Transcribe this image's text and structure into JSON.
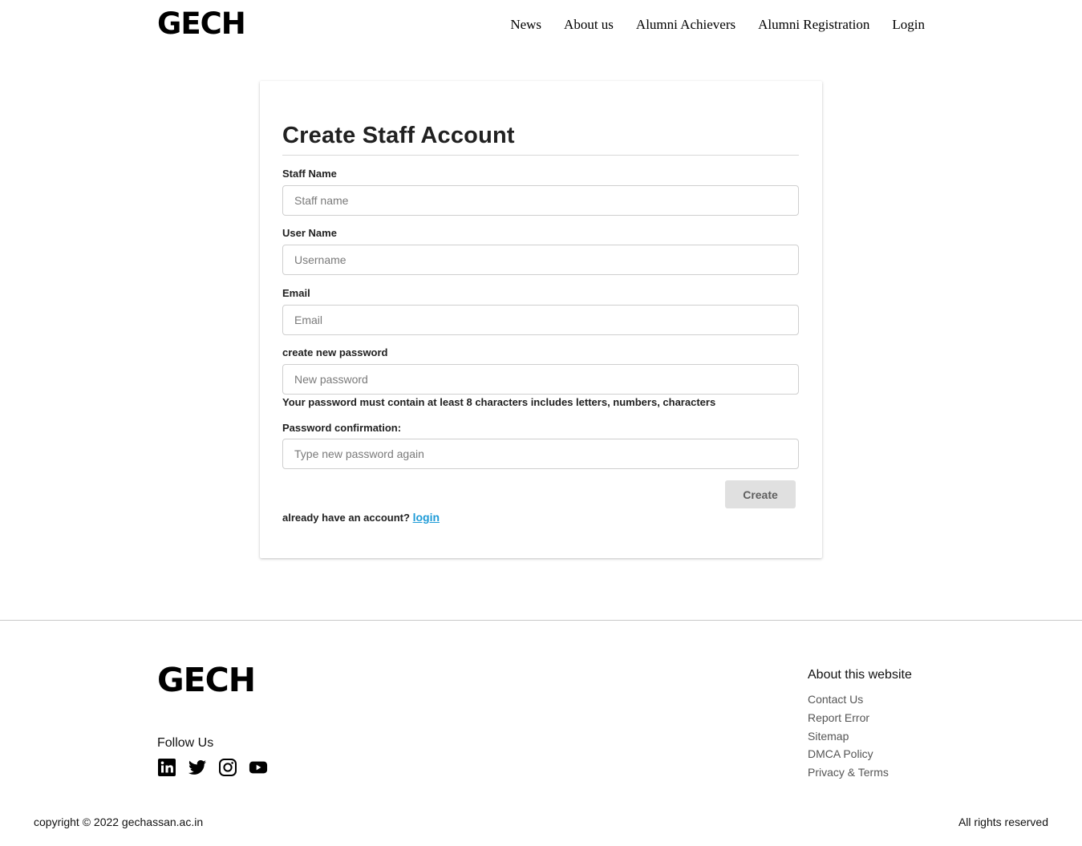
{
  "header": {
    "logo": "GECH",
    "nav": [
      "News",
      "About us",
      "Alumni Achievers",
      "Alumni Registration",
      "Login"
    ]
  },
  "form": {
    "title": "Create Staff Account",
    "fields": [
      {
        "label": "Staff Name",
        "placeholder": "Staff name"
      },
      {
        "label": "User Name",
        "placeholder": "Username"
      },
      {
        "label": "Email",
        "placeholder": "Email"
      },
      {
        "label": "create new password",
        "placeholder": "New password"
      },
      {
        "label": "Password confirmation:",
        "placeholder": "Type new password again"
      }
    ],
    "password_hint": "Your password must contain at least 8 characters includes letters, numbers, characters",
    "submit_label": "Create",
    "account_prompt": "already have an account?",
    "login_link": "login"
  },
  "footer": {
    "logo": "GECH",
    "follow_title": "Follow Us",
    "social_icons": [
      "linkedin-icon",
      "twitter-icon",
      "instagram-icon",
      "youtube-icon"
    ],
    "about_title": "About this website",
    "about_links": [
      "Contact Us",
      "Report Error",
      "Sitemap",
      "DMCA Policy",
      "Privacy & Terms"
    ],
    "copyright": "copyright © 2022 gechassan.ac.in",
    "rights": "All rights reserved"
  }
}
